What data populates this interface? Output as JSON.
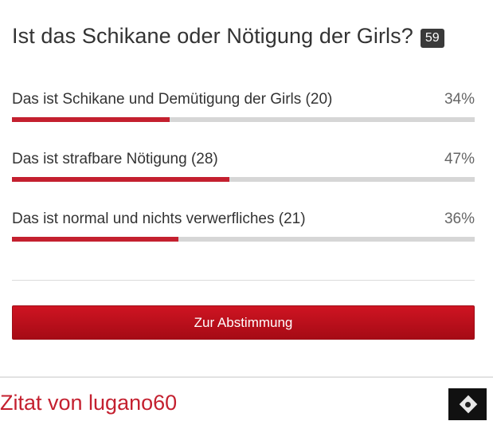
{
  "poll": {
    "title": "Ist das Schikane oder Nötigung der Girls?",
    "vote_count": "59",
    "options": [
      {
        "label": "Das ist Schikane und Demütigung der Girls (20)",
        "percent": "34%",
        "fill_percent": 34
      },
      {
        "label": "Das ist strafbare Nötigung (28)",
        "percent": "47%",
        "fill_percent": 47
      },
      {
        "label": "Das ist normal und nichts verwerfliches (21)",
        "percent": "36%",
        "fill_percent": 36
      }
    ],
    "button_label": "Zur Abstimmung"
  },
  "quote": {
    "author_label": "Zitat von lugano60"
  },
  "colors": {
    "accent": "#c4202f",
    "bar_track": "#d6d6d6",
    "badge": "#3a3a3a"
  }
}
